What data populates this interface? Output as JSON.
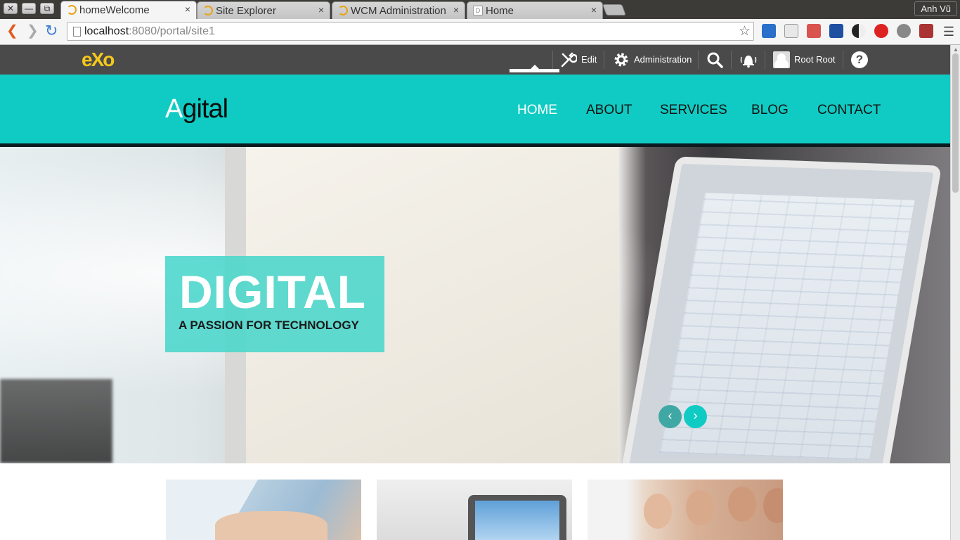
{
  "browser": {
    "window_controls": [
      "✕",
      "—",
      "⧉"
    ],
    "tabs": [
      {
        "title": "homeWelcome",
        "icon": "loading-icon",
        "active": true
      },
      {
        "title": "Site Explorer",
        "icon": "loading-icon",
        "active": false
      },
      {
        "title": "WCM Administration",
        "icon": "loading-icon",
        "active": false
      },
      {
        "title": "Home",
        "icon": "document-icon",
        "active": false
      }
    ],
    "tab_close": "×",
    "profile_name": "Anh Vũ",
    "url_host": "localhost",
    "url_path": ":8080/portal/site1"
  },
  "exo_bar": {
    "logo": "eXo",
    "edit_label": "Edit",
    "administration_label": "Administration",
    "user_name": "Root Root",
    "help": "?"
  },
  "site": {
    "brand_first": "A",
    "brand_rest": "gital",
    "nav": [
      "HOME",
      "ABOUT",
      "SERVICES",
      "BLOG",
      "CONTACT"
    ],
    "active_nav": "HOME",
    "accent_color": "#10cbc3"
  },
  "hero": {
    "title": "DIGITAL",
    "subtitle": "A PASSION FOR TECHNOLOGY",
    "prev": "‹",
    "next": "›"
  }
}
